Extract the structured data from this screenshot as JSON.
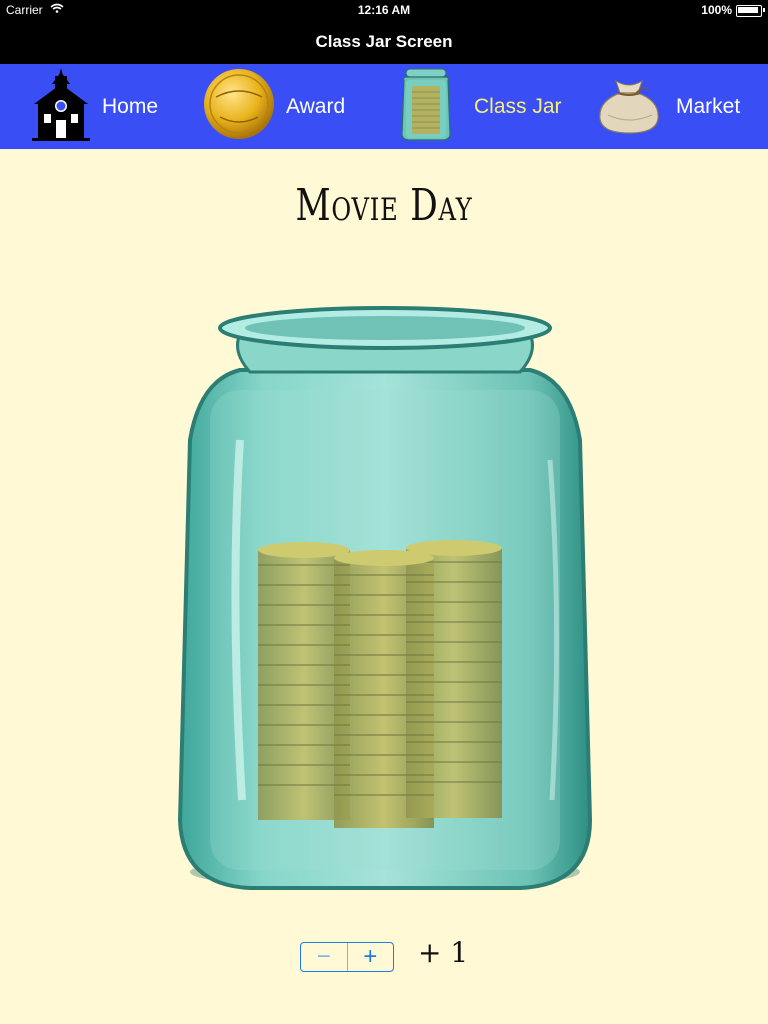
{
  "status_bar": {
    "carrier": "Carrier",
    "time": "12:16 AM",
    "battery": "100%"
  },
  "title_bar": {
    "title": "Class Jar Screen"
  },
  "tabs": [
    {
      "label": "Home",
      "icon": "schoolhouse-icon",
      "active": false
    },
    {
      "label": "Award",
      "icon": "gold-coin-icon",
      "active": false
    },
    {
      "label": "Class Jar",
      "icon": "jar-icon",
      "active": true
    },
    {
      "label": "Market",
      "icon": "money-bag-icon",
      "active": false
    }
  ],
  "main": {
    "title": "Movie Day",
    "stepper": {
      "minus_icon": "minus-icon",
      "plus_icon": "plus-icon"
    },
    "count_label": "+ 1"
  },
  "colors": {
    "tab_bar": "#3a4ef5",
    "active_tab_label": "#f6ef7a",
    "background": "#fff9d6",
    "stepper": "#1f7be6"
  }
}
